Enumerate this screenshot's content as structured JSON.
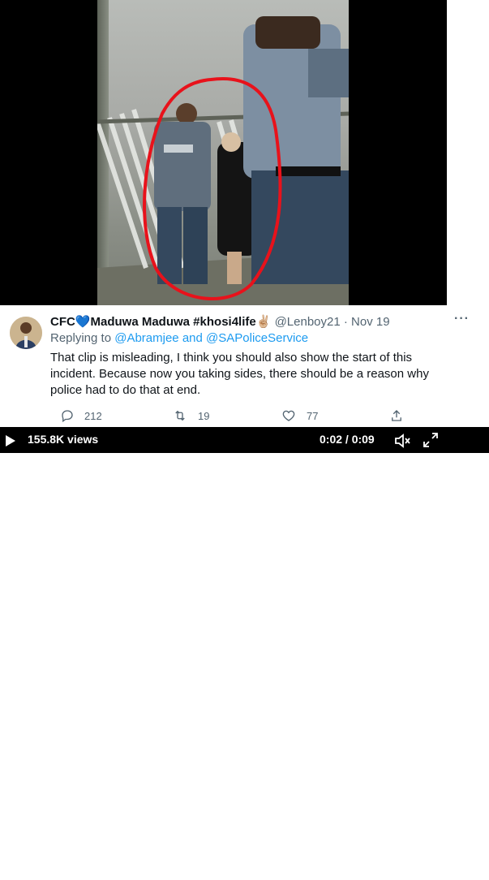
{
  "tweet": {
    "display_name": "CFC💙Maduwa Maduwa #khosi4life✌🏼",
    "handle": "@Lenboy21",
    "separator": "·",
    "date": "Nov 19",
    "replying_prefix": "Replying to",
    "replying_to": [
      "@Abramjee",
      "@SAPoliceService"
    ],
    "replying_joiner": "and",
    "text": "That clip is misleading, I think you should also show the start of this incident. Because now you taking sides, there should be a reason why police had to do that at end.",
    "actions": {
      "replies": "212",
      "retweets": "19",
      "likes": "77"
    }
  },
  "video": {
    "views": "155.8K views",
    "time": "0:02 / 0:09"
  },
  "icons": {
    "reply": "reply-icon",
    "retweet": "retweet-icon",
    "like": "heart-icon",
    "share": "share-icon",
    "more": "more-icon",
    "play": "play-icon",
    "volume": "volume-icon",
    "fullscreen": "fullscreen-icon"
  },
  "colors": {
    "link": "#1d9bf0",
    "muted": "#536471",
    "text": "#0f1419",
    "annotation": "#e8121b"
  }
}
